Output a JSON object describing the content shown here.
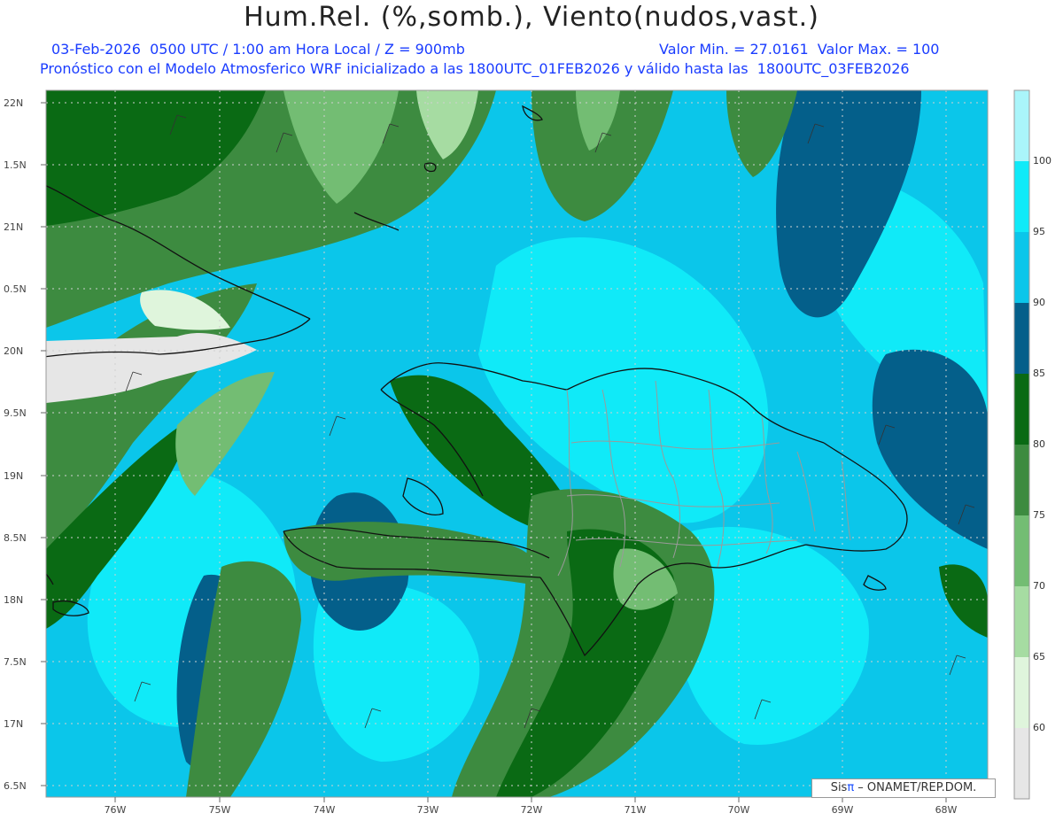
{
  "title": "Hum.Rel. (%,somb.), Viento(nudos,vast.)",
  "subtitle": {
    "date": "03-Feb-2026",
    "time": "0500 UTC / 1:00 am Hora Local / Z = 900mb",
    "min_label": "Valor Min. = 27.0161",
    "max_label": "Valor Max. = 100",
    "line2": "Pronóstico con el Modelo Atmosferico WRF inicializado a las 1800UTC_01FEB2026 y válido hasta las  1800UTC_03FEB2026"
  },
  "axes": {
    "lat_labels": [
      "22N",
      "1.5N",
      "21N",
      "0.5N",
      "20N",
      "9.5N",
      "19N",
      "8.5N",
      "18N",
      "7.5N",
      "17N",
      "6.5N"
    ],
    "lon_labels": [
      "76W",
      "75W",
      "74W",
      "73W",
      "72W",
      "71W",
      "70W",
      "69W",
      "68W"
    ]
  },
  "colorbar": {
    "labels": [
      "100",
      "95",
      "90",
      "85",
      "80",
      "75",
      "70",
      "65",
      "60"
    ],
    "colors": [
      "#aaf5fa",
      "#10eaf8",
      "#0bc6ea",
      "#045f8a",
      "#0a6a14",
      "#3d8b40",
      "#73bd73",
      "#a6dca2",
      "#dff5dc",
      "#e6e6e6"
    ]
  },
  "palette": {
    "ocean_base": "#0bc6ea",
    "very_humid": "#10eaf8",
    "dark_blue": "#045f8a",
    "dark_green": "#0a6a14",
    "mid_green": "#3d8b40",
    "light_green": "#73bd73",
    "pale_green": "#a6dca2",
    "gray_dry": "#e6e6e6",
    "grid": "#d0d0d0",
    "coast": "#111111",
    "province": "#9a9a9a"
  },
  "credit": {
    "brand": "Sis",
    "pi": "π",
    "org": " – ONAMET/REP.DOM."
  }
}
